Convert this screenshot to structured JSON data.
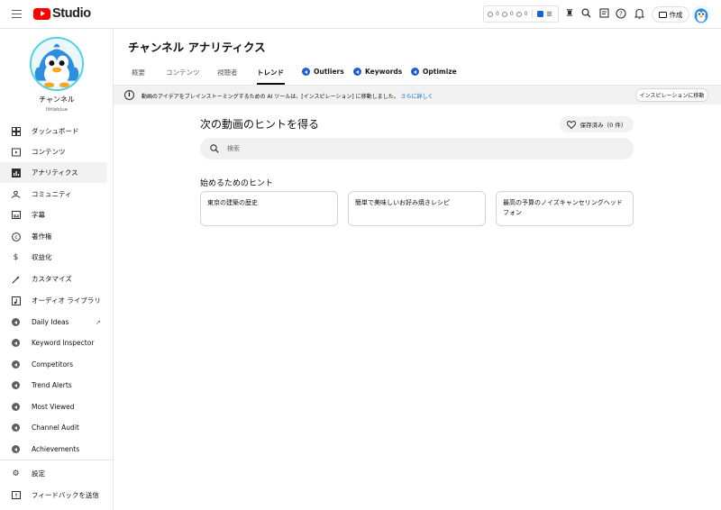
{
  "app": {
    "logo_text": "Studio"
  },
  "topbar": {
    "counters": [
      {
        "icon": "clock-icon",
        "value": "0"
      },
      {
        "icon": "eye-icon",
        "value": "0"
      },
      {
        "icon": "eye-icon",
        "value": "0"
      }
    ],
    "create_label": "作成",
    "icons": [
      "hamburger-icon",
      "extension-icon",
      "bars-icon",
      "trophy-icon",
      "search-icon",
      "feedback-icon",
      "help-icon",
      "bell-icon",
      "camera-icon"
    ]
  },
  "sidebar": {
    "channel_name": "チャンネル",
    "channel_handle": "littleblue",
    "items": [
      {
        "label": "ダッシュボード",
        "icon": "dashboard-icon"
      },
      {
        "label": "コンテンツ",
        "icon": "content-icon"
      },
      {
        "label": "アナリティクス",
        "icon": "analytics-icon"
      },
      {
        "label": "コミュニティ",
        "icon": "community-icon"
      },
      {
        "label": "字幕",
        "icon": "subtitles-icon"
      },
      {
        "label": "著作権",
        "icon": "copyright-icon"
      },
      {
        "label": "収益化",
        "icon": "dollar-icon"
      },
      {
        "label": "カスタマイズ",
        "icon": "customize-icon"
      },
      {
        "label": "オーディオ ライブラリ",
        "icon": "audio-library-icon"
      },
      {
        "label": "Daily Ideas",
        "icon": "extension-icon"
      },
      {
        "label": "Keyword Inspector",
        "icon": "extension-icon"
      },
      {
        "label": "Competitors",
        "icon": "extension-icon"
      },
      {
        "label": "Trend Alerts",
        "icon": "extension-icon"
      },
      {
        "label": "Most Viewed",
        "icon": "extension-icon"
      },
      {
        "label": "Channel Audit",
        "icon": "extension-icon"
      },
      {
        "label": "Achievements",
        "icon": "extension-icon"
      },
      {
        "label": "設定",
        "icon": "settings-icon"
      },
      {
        "label": "フィードバックを送信",
        "icon": "feedback-icon"
      }
    ],
    "active_index": 2
  },
  "main": {
    "page_title": "チャンネル アナリティクス",
    "tabs": [
      {
        "label": "概要"
      },
      {
        "label": "コンテンツ"
      },
      {
        "label": "視聴者"
      },
      {
        "label": "トレンド"
      },
      {
        "label": "Outliers"
      },
      {
        "label": "Keywords"
      },
      {
        "label": "Optimize"
      }
    ],
    "active_tab": "トレンド",
    "banner": {
      "text": "動画のアイデアをブレインストーミングするための AI ツールは、[インスピレーション] に移動しました。",
      "link": "さらに詳しく",
      "button": "インスピレーションに移動"
    },
    "section_title": "次の動画のヒントを得る",
    "save_button": "保存済み（0 件）",
    "search_placeholder": "検索",
    "hints_title": "始めるためのヒント",
    "hints": [
      "東京の建築の歴史",
      "簡単で美味しいお好み焼きレシピ",
      "最高の予算のノイズキャンセリングヘッドフォン"
    ]
  },
  "colors": {
    "brand_red": "#ff0000",
    "link_blue": "#065fd4",
    "extension_blue": "#1f5fd6"
  }
}
